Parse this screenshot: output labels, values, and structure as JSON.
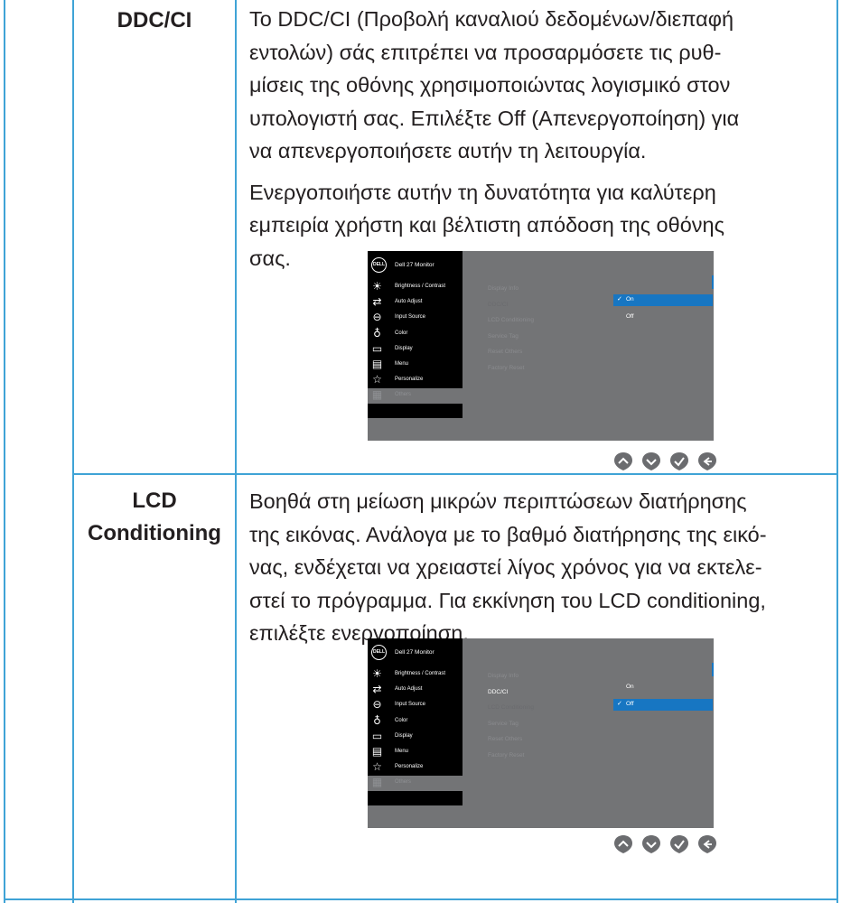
{
  "rows": [
    {
      "label_lines": [
        "DDC/CI"
      ],
      "paragraphs": [
        [
          "Το DDC/CI (Προβολή καναλιού δεδομένων/διεπαφή",
          "εντολών) σάς επιτρέπει να προσαρμόσετε τις ρυθ-",
          "μίσεις της οθόνης χρησιμοποιώντας λογισμικό στον",
          "υπολογιστή σας. Επιλέξτε Off (Απενεργοποίηση) για",
          "να απενεργοποιήσετε αυτήν τη λειτουργία."
        ],
        [
          "Ενεργοποιήστε αυτήν τη δυνατότητα για καλύτερη",
          "εμπειρία χρήστη και βέλτιστη απόδοση της οθόνης",
          "σας."
        ]
      ],
      "osd": {
        "logo": "DELL",
        "model": "Dell 27 Monitor",
        "menu": [
          {
            "icon": "brightness-icon",
            "glyph": "☀",
            "label": "Brightness / Contrast"
          },
          {
            "icon": "auto-adjust-icon",
            "glyph": "⇄",
            "label": "Auto Adjust"
          },
          {
            "icon": "input-source-icon",
            "glyph": "⊖",
            "label": "Input Source"
          },
          {
            "icon": "color-icon",
            "glyph": "♁",
            "label": "Color"
          },
          {
            "icon": "display-icon",
            "glyph": "▭",
            "label": "Display"
          },
          {
            "icon": "menu-icon",
            "glyph": "▤",
            "label": "Menu"
          },
          {
            "icon": "personalize-icon",
            "glyph": "☆",
            "label": "Personalize"
          },
          {
            "icon": "others-icon",
            "glyph": "▦",
            "label": "Others"
          }
        ],
        "submenu": [
          "Display Info",
          "DDC/CI",
          "LCD Conditioning",
          "Service Tag",
          "Reset Others",
          "Factory Reset"
        ],
        "active_sub": 1,
        "options": [
          "On",
          "Off"
        ],
        "selected_option": 0,
        "check_glyph": "✓"
      }
    },
    {
      "label_lines": [
        "LCD",
        "Conditioning"
      ],
      "paragraphs": [
        [
          "Βοηθά στη μείωση μικρών περιπτώσεων διατήρησης",
          "της εικόνας. Ανάλογα με το βαθμό διατήρησης της εικό-",
          "νας, ενδέχεται να χρειαστεί λίγος χρόνος για να εκτελε-",
          "στεί το πρόγραμμα. Για εκκίνηση του LCD conditioning,",
          "επιλέξτε ενεργοποίηση."
        ]
      ],
      "osd": {
        "logo": "DELL",
        "model": "Dell 27 Monitor",
        "menu": [
          {
            "icon": "brightness-icon",
            "glyph": "☀",
            "label": "Brightness / Contrast"
          },
          {
            "icon": "auto-adjust-icon",
            "glyph": "⇄",
            "label": "Auto Adjust"
          },
          {
            "icon": "input-source-icon",
            "glyph": "⊖",
            "label": "Input Source"
          },
          {
            "icon": "color-icon",
            "glyph": "♁",
            "label": "Color"
          },
          {
            "icon": "display-icon",
            "glyph": "▭",
            "label": "Display"
          },
          {
            "icon": "menu-icon",
            "glyph": "▤",
            "label": "Menu"
          },
          {
            "icon": "personalize-icon",
            "glyph": "☆",
            "label": "Personalize"
          },
          {
            "icon": "others-icon",
            "glyph": "▦",
            "label": "Others"
          }
        ],
        "submenu": [
          "Display Info",
          "DDC/CI",
          "LCD Conditioning",
          "Service Tag",
          "Reset Others",
          "Factory Reset"
        ],
        "active_sub": 2,
        "bright_sub": 1,
        "options": [
          "On",
          "Off"
        ],
        "selected_option": 1,
        "check_glyph": "✓"
      }
    }
  ],
  "nav_buttons": [
    "up-button",
    "down-button",
    "select-button",
    "back-button"
  ],
  "colors": {
    "border": "#3fa3d6",
    "osd_bg": "#737476",
    "highlight": "#1776c2",
    "button": "#6b6c6f"
  }
}
